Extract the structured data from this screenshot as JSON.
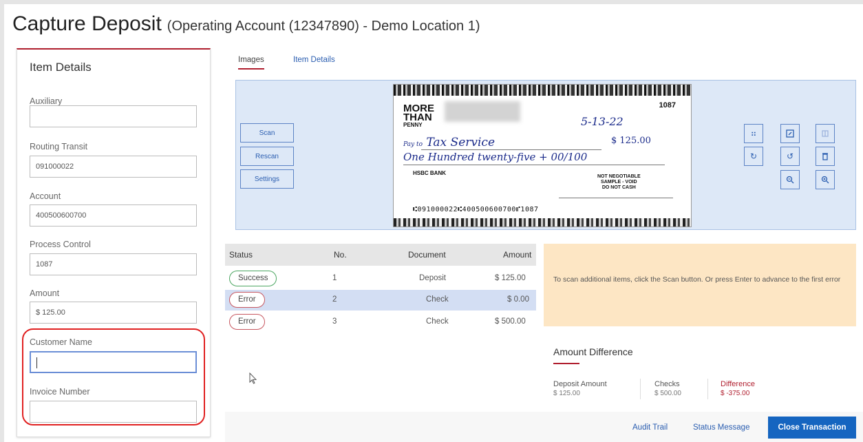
{
  "page": {
    "title": "Capture Deposit",
    "subtitle": "(Operating Account (12347890) - Demo Location 1)"
  },
  "item_details": {
    "heading": "Item Details",
    "fields": [
      {
        "label": "Auxiliary",
        "value": ""
      },
      {
        "label": "Routing Transit",
        "value": "091000022"
      },
      {
        "label": "Account",
        "value": "400500600700"
      },
      {
        "label": "Process Control",
        "value": "1087"
      },
      {
        "label": "Amount",
        "value": "$ 125.00"
      },
      {
        "label": "Customer Name",
        "value": ""
      },
      {
        "label": "Invoice Number",
        "value": ""
      }
    ]
  },
  "tabs": [
    {
      "label": "Images",
      "active": true
    },
    {
      "label": "Item Details",
      "active": false
    }
  ],
  "scanner": {
    "buttons": [
      "Scan",
      "Rescan",
      "Settings"
    ],
    "tool_icons": [
      "fit-icon",
      "expand-icon",
      "split-icon",
      "rotate-right-icon",
      "rotate-left-icon",
      "delete-icon",
      "zoom-out-icon",
      "zoom-in-icon"
    ]
  },
  "check_image": {
    "logo": "MORE THAN",
    "logo_line3": "PENNY",
    "check_number": "1087",
    "date": "5-13-22",
    "payee": "Tax Service",
    "pay_to_prefix": "Pay to",
    "amount": "$ 125.00",
    "amount_words": "One Hundred twenty-five + 00/100",
    "bank": "HSBC BANK",
    "void_lines": [
      "NOT NEGOTIABLE",
      "SAMPLE - VOID",
      "DO NOT CASH"
    ],
    "micr": "⑆091000022⑆400500600700⑈1087"
  },
  "table": {
    "headers": [
      "Status",
      "No.",
      "Document",
      "Amount"
    ],
    "rows": [
      {
        "status": "Success",
        "no": "1",
        "document": "Deposit",
        "amount": "$ 125.00"
      },
      {
        "status": "Error",
        "no": "2",
        "document": "Check",
        "amount": "$ 0.00"
      },
      {
        "status": "Error",
        "no": "3",
        "document": "Check",
        "amount": "$ 500.00"
      }
    ]
  },
  "message": {
    "text": "To scan additional items, click the Scan button. Or press Enter to advance to the first error"
  },
  "amount_difference": {
    "title": "Amount Difference",
    "deposit_label": "Deposit Amount",
    "deposit_value": "$ 125.00",
    "checks_label": "Checks",
    "checks_value": "$ 500.00",
    "difference_label": "Difference",
    "difference_value": "$ -375.00"
  },
  "footer": {
    "audit_trail": "Audit Trail",
    "status_message": "Status Message",
    "close_transaction": "Close Transaction"
  },
  "colors": {
    "accent_red": "#b01e2e",
    "link_blue": "#2a5db0",
    "primary_blue": "#1565c0",
    "scanner_bg": "#dde8f7",
    "message_bg": "#fde6c4",
    "success_green": "#4aa560"
  }
}
